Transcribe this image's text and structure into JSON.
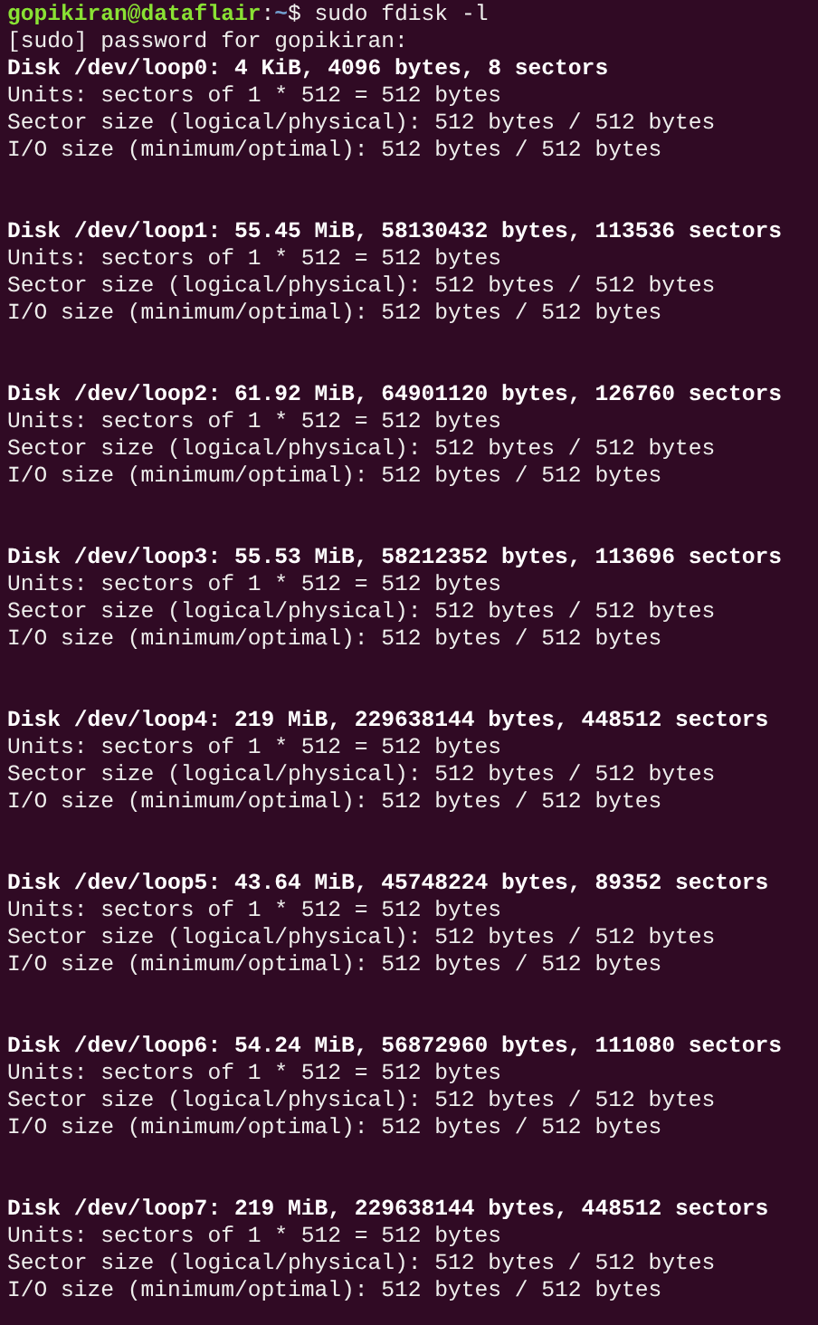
{
  "prompt": {
    "user_host": "gopikiran@dataflair",
    "separator": ":",
    "path": "~",
    "symbol": "$",
    "command": "sudo fdisk -l"
  },
  "sudo_prompt": "[sudo] password for gopikiran:",
  "disks": [
    {
      "header": "Disk /dev/loop0: 4 KiB, 4096 bytes, 8 sectors",
      "units": "Units: sectors of 1 * 512 = 512 bytes",
      "sector_size": "Sector size (logical/physical): 512 bytes / 512 bytes",
      "io_size": "I/O size (minimum/optimal): 512 bytes / 512 bytes"
    },
    {
      "header": "Disk /dev/loop1: 55.45 MiB, 58130432 bytes, 113536 sectors",
      "units": "Units: sectors of 1 * 512 = 512 bytes",
      "sector_size": "Sector size (logical/physical): 512 bytes / 512 bytes",
      "io_size": "I/O size (minimum/optimal): 512 bytes / 512 bytes"
    },
    {
      "header": "Disk /dev/loop2: 61.92 MiB, 64901120 bytes, 126760 sectors",
      "units": "Units: sectors of 1 * 512 = 512 bytes",
      "sector_size": "Sector size (logical/physical): 512 bytes / 512 bytes",
      "io_size": "I/O size (minimum/optimal): 512 bytes / 512 bytes"
    },
    {
      "header": "Disk /dev/loop3: 55.53 MiB, 58212352 bytes, 113696 sectors",
      "units": "Units: sectors of 1 * 512 = 512 bytes",
      "sector_size": "Sector size (logical/physical): 512 bytes / 512 bytes",
      "io_size": "I/O size (minimum/optimal): 512 bytes / 512 bytes"
    },
    {
      "header": "Disk /dev/loop4: 219 MiB, 229638144 bytes, 448512 sectors",
      "units": "Units: sectors of 1 * 512 = 512 bytes",
      "sector_size": "Sector size (logical/physical): 512 bytes / 512 bytes",
      "io_size": "I/O size (minimum/optimal): 512 bytes / 512 bytes"
    },
    {
      "header": "Disk /dev/loop5: 43.64 MiB, 45748224 bytes, 89352 sectors",
      "units": "Units: sectors of 1 * 512 = 512 bytes",
      "sector_size": "Sector size (logical/physical): 512 bytes / 512 bytes",
      "io_size": "I/O size (minimum/optimal): 512 bytes / 512 bytes"
    },
    {
      "header": "Disk /dev/loop6: 54.24 MiB, 56872960 bytes, 111080 sectors",
      "units": "Units: sectors of 1 * 512 = 512 bytes",
      "sector_size": "Sector size (logical/physical): 512 bytes / 512 bytes",
      "io_size": "I/O size (minimum/optimal): 512 bytes / 512 bytes"
    },
    {
      "header": "Disk /dev/loop7: 219 MiB, 229638144 bytes, 448512 sectors",
      "units": "Units: sectors of 1 * 512 = 512 bytes",
      "sector_size": "Sector size (logical/physical): 512 bytes / 512 bytes",
      "io_size": "I/O size (minimum/optimal): 512 bytes / 512 bytes"
    }
  ]
}
